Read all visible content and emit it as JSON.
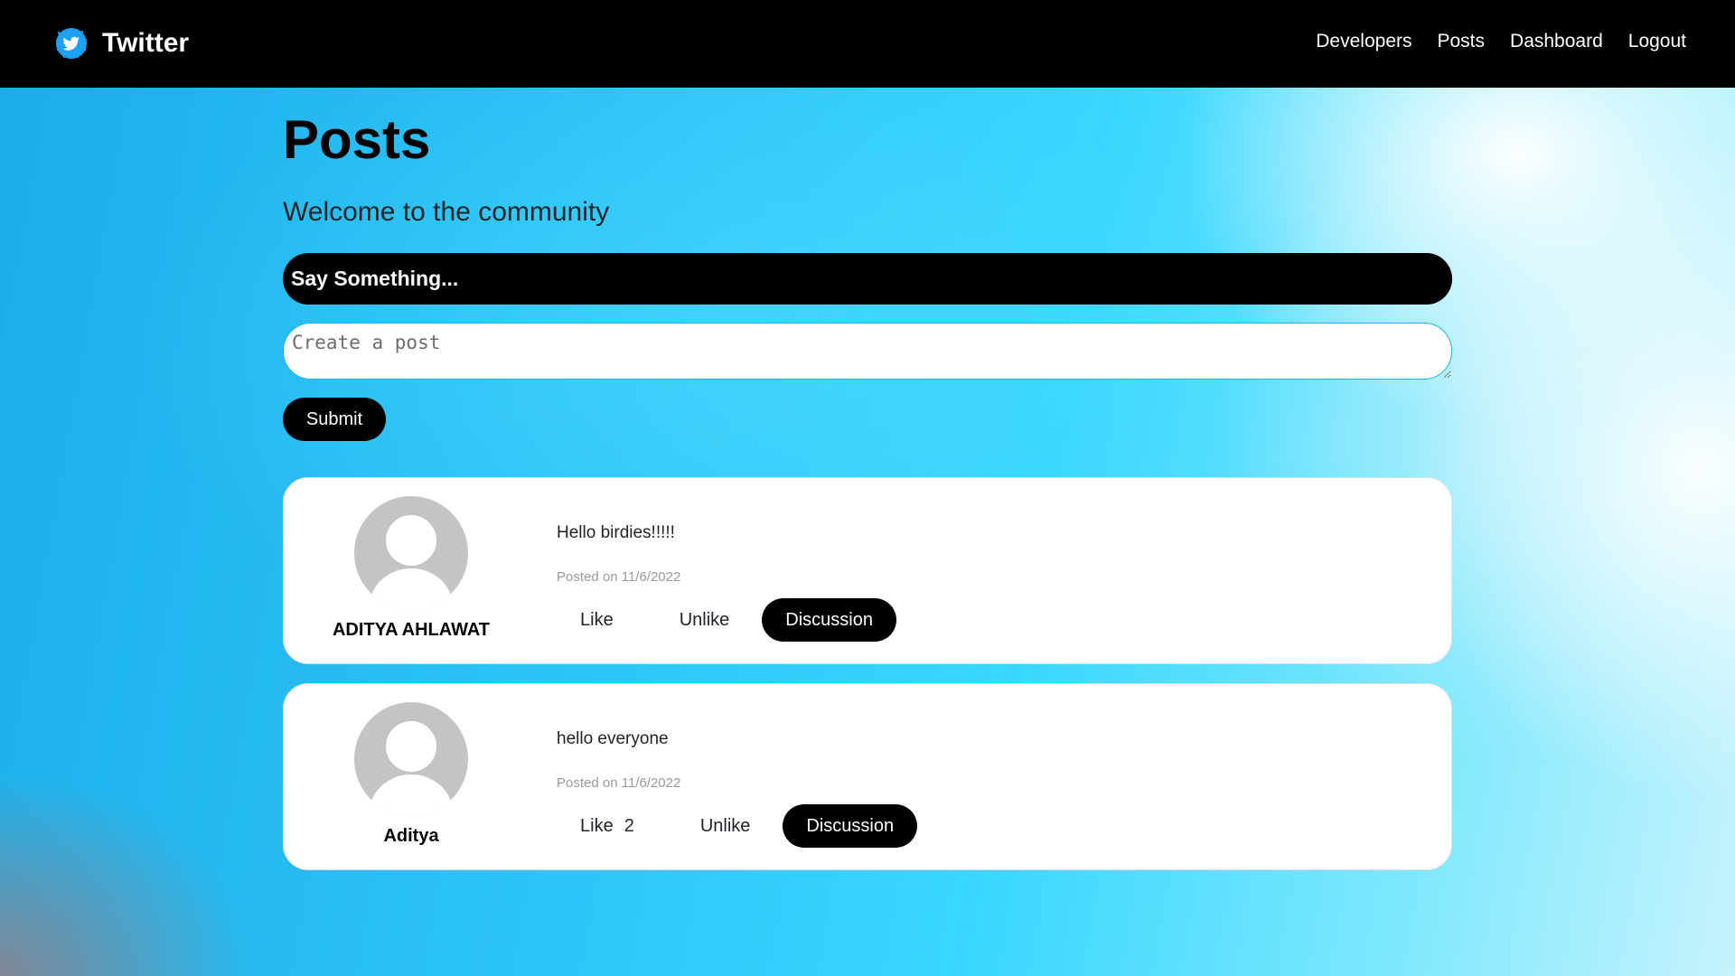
{
  "navbar": {
    "brand": "Twitter",
    "links": [
      "Developers",
      "Posts",
      "Dashboard",
      "Logout"
    ]
  },
  "page": {
    "title": "Posts",
    "lead": "Welcome to the community"
  },
  "form": {
    "header": "Say Something...",
    "placeholder": "Create a post",
    "submit_label": "Submit"
  },
  "posts": [
    {
      "author": "ADITYA AHLAWAT",
      "text": "Hello birdies!!!!!",
      "date": "Posted on 11/6/2022",
      "like_label": "Like",
      "like_count": "",
      "unlike_label": "Unlike",
      "discussion_label": "Discussion"
    },
    {
      "author": "Aditya",
      "text": "hello everyone",
      "date": "Posted on 11/6/2022",
      "like_label": "Like",
      "like_count": "2",
      "unlike_label": "Unlike",
      "discussion_label": "Discussion"
    }
  ],
  "colors": {
    "navbar": "#000000",
    "accent": "#1da1f2",
    "card": "#ffffff",
    "avatar": "#c4c4c4"
  },
  "icons": {
    "brand": "twitter-bird-icon",
    "avatar": "default-user-avatar-icon"
  }
}
